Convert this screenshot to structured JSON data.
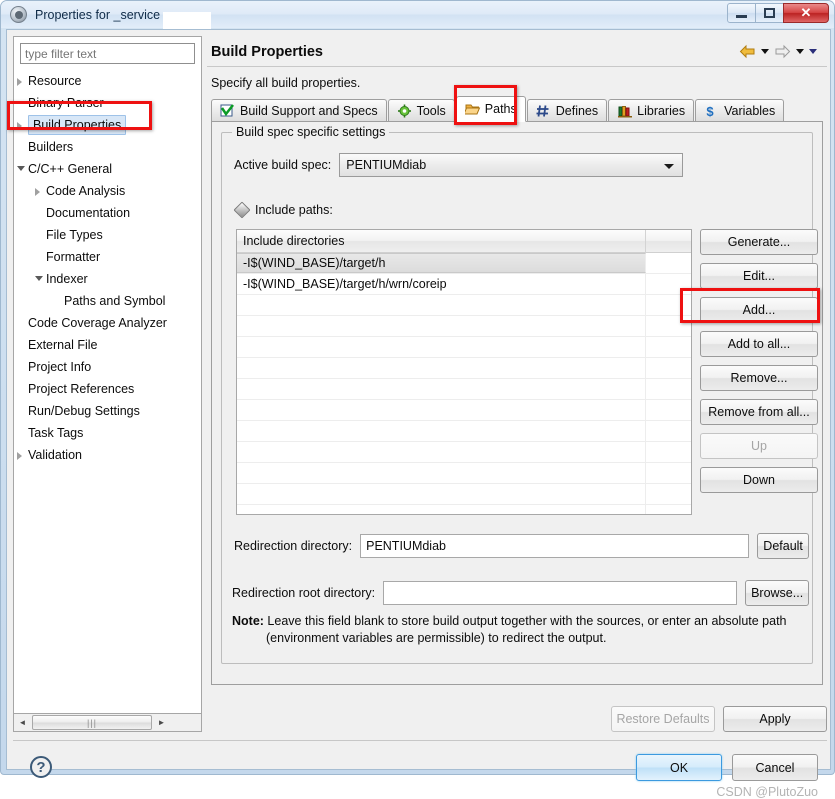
{
  "window": {
    "title": "Properties for                _service",
    "title_prefix": "Properties for",
    "title_suffix": "_service",
    "minimize_label": "Minimize",
    "maximize_label": "Maximize",
    "close_label": "✕"
  },
  "sidebar": {
    "filter_placeholder": "type filter text",
    "filter_value": "",
    "items": [
      {
        "label": "Resource",
        "indent": 0,
        "twisty": "closed",
        "selected": false
      },
      {
        "label": "Binary Parser",
        "indent": 0,
        "twisty": "none",
        "selected": false
      },
      {
        "label": "Build Properties",
        "indent": 0,
        "twisty": "closed",
        "selected": true
      },
      {
        "label": "Builders",
        "indent": 0,
        "twisty": "none",
        "selected": false
      },
      {
        "label": "C/C++ General",
        "indent": 0,
        "twisty": "open",
        "selected": false
      },
      {
        "label": "Code Analysis",
        "indent": 1,
        "twisty": "closed",
        "selected": false
      },
      {
        "label": "Documentation",
        "indent": 1,
        "twisty": "none",
        "selected": false
      },
      {
        "label": "File Types",
        "indent": 1,
        "twisty": "none",
        "selected": false
      },
      {
        "label": "Formatter",
        "indent": 1,
        "twisty": "none",
        "selected": false
      },
      {
        "label": "Indexer",
        "indent": 1,
        "twisty": "open",
        "selected": false
      },
      {
        "label": "Paths and Symbol",
        "indent": 2,
        "twisty": "none",
        "selected": false
      },
      {
        "label": "Code Coverage Analyzer",
        "indent": 0,
        "twisty": "none",
        "selected": false
      },
      {
        "label": "External File",
        "indent": 0,
        "twisty": "none",
        "selected": false
      },
      {
        "label": "Project Info",
        "indent": 0,
        "twisty": "none",
        "selected": false
      },
      {
        "label": "Project References",
        "indent": 0,
        "twisty": "none",
        "selected": false
      },
      {
        "label": "Run/Debug Settings",
        "indent": 0,
        "twisty": "none",
        "selected": false
      },
      {
        "label": "Task Tags",
        "indent": 0,
        "twisty": "none",
        "selected": false
      },
      {
        "label": "Validation",
        "indent": 0,
        "twisty": "closed",
        "selected": false
      }
    ],
    "scrollbar": {
      "left_arrow": "◄",
      "right_arrow": "►",
      "grip": "|||"
    }
  },
  "header": {
    "title": "Build Properties",
    "description": "Specify all build properties.",
    "nav": {
      "back_icon": "back-arrow-icon",
      "back_menu_icon": "chevron-down-icon",
      "forward_icon": "forward-arrow-icon",
      "forward_menu_icon": "chevron-down-icon",
      "more_icon": "chevron-down-icon"
    }
  },
  "tabs": [
    {
      "label": "Build Support and Specs",
      "icon": "checked-document-icon",
      "active": false
    },
    {
      "label": "Tools",
      "icon": "gear-green-icon",
      "active": false
    },
    {
      "label": "Paths",
      "icon": "open-folder-icon",
      "active": true
    },
    {
      "label": "Defines",
      "icon": "hash-icon",
      "active": false
    },
    {
      "label": "Libraries",
      "icon": "books-icon",
      "active": false
    },
    {
      "label": "Variables",
      "icon": "dollar-icon",
      "active": false
    }
  ],
  "panel": {
    "group_legend": "Build spec specific settings",
    "active_build_spec_label": "Active build spec:",
    "active_build_spec_value": "PENTIUMdiab",
    "include_paths_label": "Include paths:",
    "include_paths_icon": "pencil-icon",
    "table": {
      "columns": [
        "Include directories",
        ""
      ],
      "rows": [
        {
          "path": "-I$(WIND_BASE)/target/h",
          "selected": true
        },
        {
          "path": "-I$(WIND_BASE)/target/h/wrn/coreip",
          "selected": false
        }
      ],
      "empty_row_count": 11
    },
    "side_buttons": [
      {
        "label": "Generate...",
        "enabled": true,
        "highlighted": false
      },
      {
        "label": "Edit...",
        "enabled": true,
        "highlighted": false
      },
      {
        "label": "Add...",
        "enabled": true,
        "highlighted": true
      },
      {
        "label": "Add to all...",
        "enabled": true,
        "highlighted": false
      },
      {
        "label": "Remove...",
        "enabled": true,
        "highlighted": false
      },
      {
        "label": "Remove from all...",
        "enabled": true,
        "highlighted": false
      },
      {
        "label": "Up",
        "enabled": false,
        "highlighted": false
      },
      {
        "label": "Down",
        "enabled": true,
        "highlighted": false
      }
    ],
    "redirection_directory_label": "Redirection directory:",
    "redirection_directory_value": "PENTIUMdiab",
    "default_button": "Default",
    "redirection_root_label": "Redirection root directory:",
    "redirection_root_value": "",
    "browse_button": "Browse...",
    "note_prefix": "Note:",
    "note_line1": " Leave this field blank to store build output together with the sources, or enter an absolute path",
    "note_line2": "(environment variables are permissible) to redirect the output."
  },
  "footer": {
    "restore_defaults": "Restore Defaults",
    "restore_defaults_enabled": false,
    "apply": "Apply",
    "ok": "OK",
    "cancel": "Cancel",
    "watermark": "CSDN @PlutoZuo"
  },
  "colors": {
    "highlight": "#ee1111",
    "selection": "#d8e7f7",
    "ok_accent": "#3c9adf"
  }
}
